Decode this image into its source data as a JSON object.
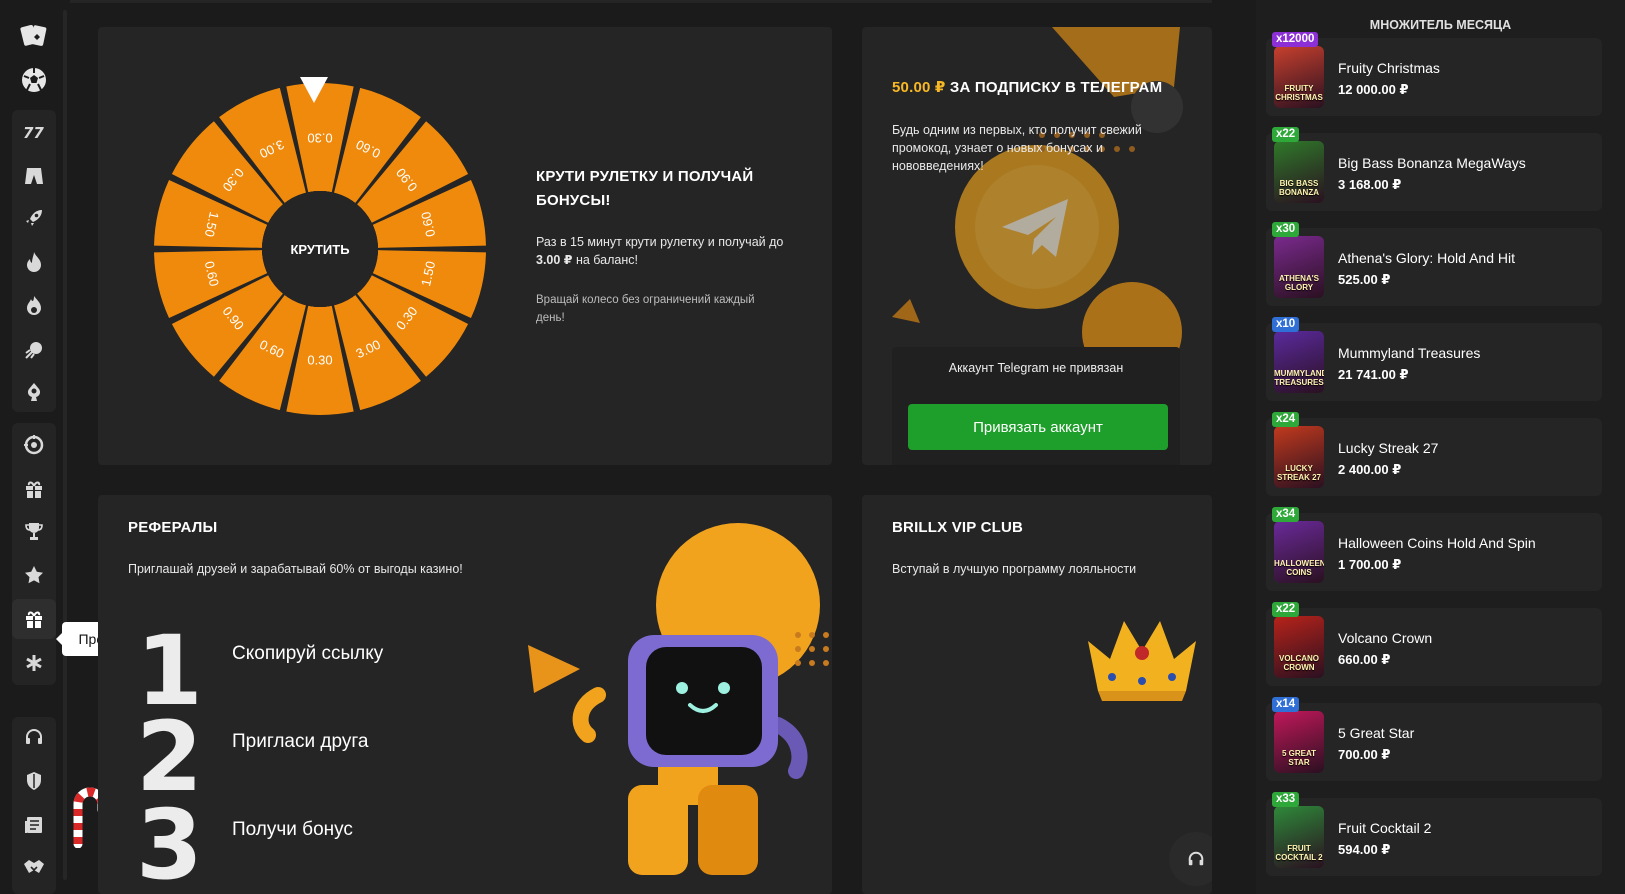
{
  "sidebar": {
    "icons": [
      "cards-icon",
      "soccer-ball-icon",
      "slot-777-icon",
      "gem-pants-icon",
      "rocket-icon",
      "flame-icon",
      "fire-icon",
      "meteor-icon",
      "poker-chip-icon",
      "wheel-icon",
      "gift-icon",
      "trophy-icon",
      "star-icon",
      "gift-active-icon",
      "asterisk-icon",
      "headset-icon",
      "shield-icon",
      "news-icon",
      "handshake-icon"
    ],
    "tooltip": "Промо"
  },
  "wheel": {
    "title": "КРУТИ РУЛЕТКУ И ПОЛУЧАЙ БОНУСЫ!",
    "desc_prefix": "Раз в 15 минут крути рулетку и получай до ",
    "desc_amount": "3.00 ₽",
    "desc_suffix": " на баланс!",
    "note": "Вращай колесо без ограничений каждый день!",
    "spin_label": "КРУТИТЬ",
    "segments": [
      "0.30",
      "0.60",
      "0.90",
      "0.60",
      "1.50",
      "0.30",
      "3.00",
      "0.30",
      "0.60",
      "0.90",
      "0.60",
      "1.50",
      "0.30",
      "3.00"
    ],
    "color": "#f08a0c"
  },
  "telegram": {
    "amount": "50.00 ₽",
    "title_rest": " ЗА ПОДПИСКУ В ТЕЛЕГРАМ",
    "desc": "Будь одним из первых, кто получит свежий промокод, узнает о новых бонусах и нововведениях!",
    "status": "Аккаунт Telegram не привязан",
    "button": "Привязать аккаунт"
  },
  "referrals": {
    "title": "РЕФЕРАЛЫ",
    "desc": "Приглашай друзей и зарабатывай 60% от выгоды казино!",
    "steps": [
      {
        "num": "1",
        "text": "Скопируй ссылку"
      },
      {
        "num": "2",
        "text": "Пригласи друга"
      },
      {
        "num": "3",
        "text": "Получи бонус"
      }
    ]
  },
  "vip": {
    "title": "BRILLX VIP CLUB",
    "desc": "Вступай в лучшую программу лояльности"
  },
  "multipliers": {
    "title": "МНОЖИТЕЛЬ МЕСЯЦА",
    "items": [
      {
        "mult": "x12000",
        "name": "Fruity Christmas",
        "value": "12 000.00 ₽",
        "thumb": "FRUITY CHRISTMAS",
        "bg": "#c8402e",
        "badge": "#8c2fd6"
      },
      {
        "mult": "x22",
        "name": "Big Bass Bonanza MegaWays",
        "value": "3 168.00 ₽",
        "thumb": "BIG BASS BONANZA",
        "bg": "#2f7a2a",
        "badge": "#2fa83a"
      },
      {
        "mult": "x30",
        "name": "Athena's Glory: Hold And Hit",
        "value": "525.00 ₽",
        "thumb": "ATHENA'S GLORY",
        "bg": "#7a2a8e",
        "badge": "#2fa83a"
      },
      {
        "mult": "x10",
        "name": "Mummyland Treasures",
        "value": "21 741.00 ₽",
        "thumb": "MUMMYLAND TREASURES",
        "bg": "#5a2a9e",
        "badge": "#2f6fd6"
      },
      {
        "mult": "x24",
        "name": "Lucky Streak 27",
        "value": "2 400.00 ₽",
        "thumb": "LUCKY STREAK 27",
        "bg": "#c23a1e",
        "badge": "#2fa83a"
      },
      {
        "mult": "x34",
        "name": "Halloween Coins Hold And Spin",
        "value": "1 700.00 ₽",
        "thumb": "HALLOWEEN COINS",
        "bg": "#6a2a9a",
        "badge": "#2fa83a"
      },
      {
        "mult": "x22",
        "name": "Volcano Crown",
        "value": "660.00 ₽",
        "thumb": "VOLCANO CROWN",
        "bg": "#b8231a",
        "badge": "#2fa83a"
      },
      {
        "mult": "x14",
        "name": "5 Great Star",
        "value": "700.00 ₽",
        "thumb": "5 GREAT STAR",
        "bg": "#c2185b",
        "badge": "#2f6fd6"
      },
      {
        "mult": "x33",
        "name": "Fruit Cocktail 2",
        "value": "594.00 ₽",
        "thumb": "FRUIT COCKTAIL 2",
        "bg": "#2e8a3a",
        "badge": "#2fa83a"
      }
    ]
  }
}
